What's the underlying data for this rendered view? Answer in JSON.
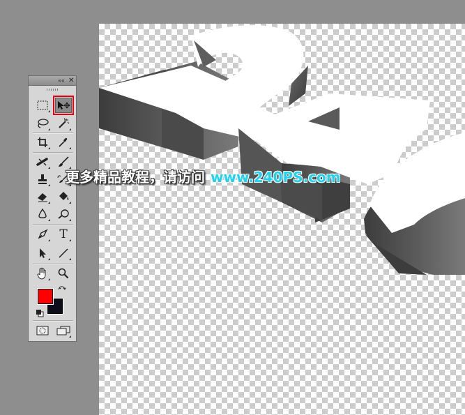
{
  "canvas": {
    "layer_text": "240",
    "text_color": "#ffffff",
    "extrusion_color": "#4f4f4f"
  },
  "toolbox": {
    "collapse_glyph": "««",
    "close_glyph": "✕",
    "active_tool": "move-tool",
    "tools": [
      {
        "name": "rectangular-marquee-tool",
        "icon": "marquee-icon"
      },
      {
        "name": "move-tool",
        "icon": "move-icon"
      },
      {
        "name": "lasso-tool",
        "icon": "lasso-icon"
      },
      {
        "name": "magic-wand-tool",
        "icon": "magic-wand-icon"
      },
      {
        "name": "crop-tool",
        "icon": "crop-icon"
      },
      {
        "name": "eyedropper-tool",
        "icon": "eyedropper-icon"
      },
      {
        "name": "spot-healing-tool",
        "icon": "healing-icon"
      },
      {
        "name": "brush-tool",
        "icon": "brush-icon"
      },
      {
        "name": "clone-stamp-tool",
        "icon": "stamp-icon"
      },
      {
        "name": "history-brush-tool",
        "icon": "history-brush-icon"
      },
      {
        "name": "eraser-tool",
        "icon": "eraser-icon"
      },
      {
        "name": "paint-bucket-tool",
        "icon": "bucket-icon"
      },
      {
        "name": "blur-tool",
        "icon": "blur-drop-icon"
      },
      {
        "name": "dodge-tool",
        "icon": "dodge-icon"
      },
      {
        "name": "pen-tool",
        "icon": "pen-icon"
      },
      {
        "name": "type-tool",
        "icon": "type-icon",
        "glyph": "T"
      },
      {
        "name": "path-selection-tool",
        "icon": "arrow-icon"
      },
      {
        "name": "line-tool",
        "icon": "line-icon"
      },
      {
        "name": "hand-tool",
        "icon": "hand-icon"
      },
      {
        "name": "zoom-tool",
        "icon": "magnifier-icon"
      },
      {
        "name": "quick-mask-mode",
        "icon": "quick-mask-icon"
      },
      {
        "name": "screen-mode",
        "icon": "screen-mode-icon"
      }
    ],
    "foreground_color": "#ff0000",
    "background_color": "#0d0d1a"
  },
  "watermark": {
    "chinese_text": "更多精品教程，请访问",
    "url": "www.240PS.com",
    "url_color": "#1fd3f0"
  }
}
